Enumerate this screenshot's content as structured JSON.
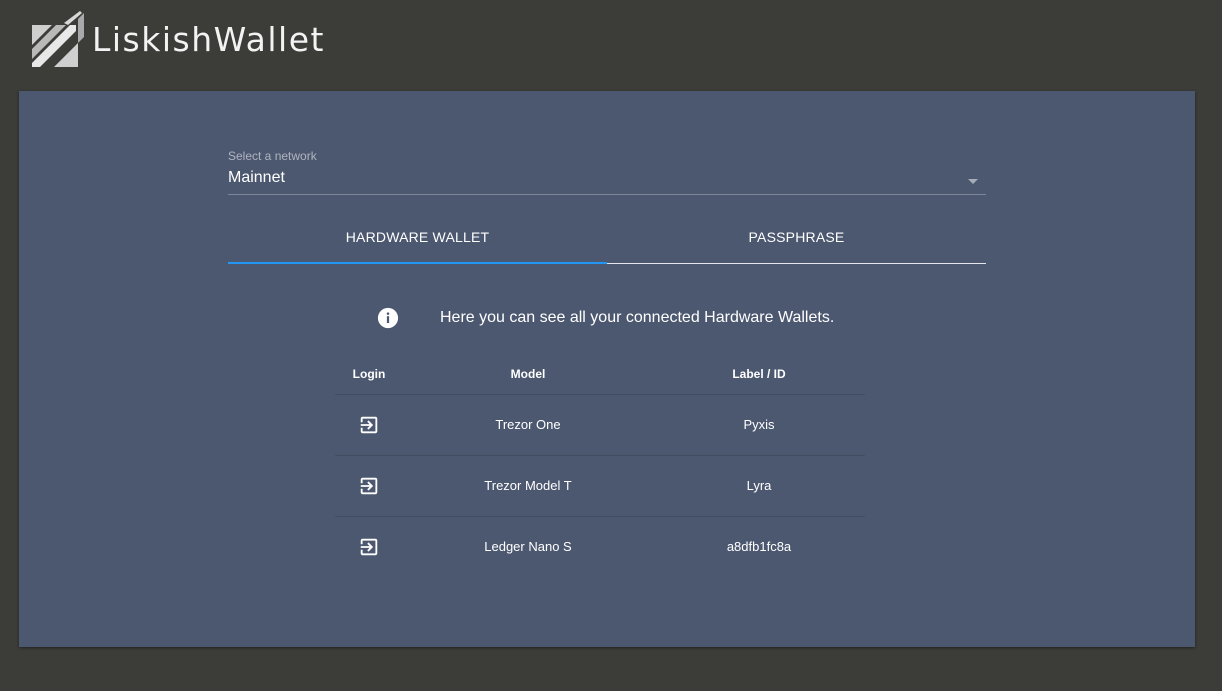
{
  "app": {
    "name": "LiskishWallet"
  },
  "network": {
    "label": "Select a network",
    "selected": "Mainnet"
  },
  "tabs": [
    {
      "label": "HARDWARE WALLET",
      "active": true
    },
    {
      "label": "PASSPHRASE",
      "active": false
    }
  ],
  "info": {
    "icon": "info-icon",
    "text": "Here you can see all your connected Hardware Wallets."
  },
  "table": {
    "headers": {
      "login": "Login",
      "model": "Model",
      "label": "Label / ID"
    },
    "rows": [
      {
        "model": "Trezor One",
        "label": "Pyxis"
      },
      {
        "model": "Trezor Model T",
        "label": "Lyra"
      },
      {
        "model": "Ledger Nano S",
        "label": "a8dfb1fc8a"
      }
    ],
    "login_icon": "login-icon"
  },
  "colors": {
    "background": "#3c3c38",
    "card": "#4c5870",
    "accent": "#2196f3"
  }
}
